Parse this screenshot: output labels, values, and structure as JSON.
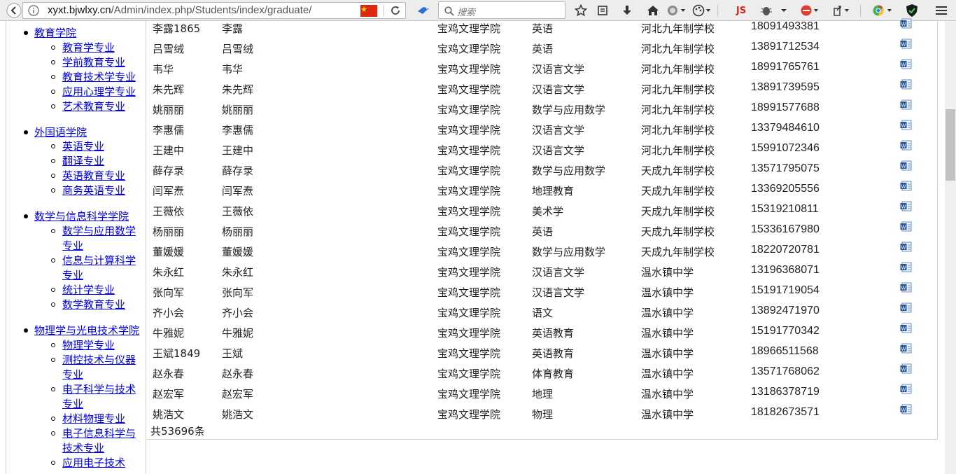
{
  "browser": {
    "url_host": "xyxt.bjwlxy.cn",
    "url_path": "/Admin/index.php/Students/index/graduate/",
    "search_placeholder": "搜索",
    "js_label": "JS",
    "accent_flag": "#d22",
    "icons": [
      "back-icon",
      "info-icon",
      "china-flag-icon",
      "reload-icon",
      "bird-icon",
      "search-icon",
      "star-icon",
      "reader-icon",
      "download-icon",
      "home-icon",
      "globe-icon",
      "palette-icon",
      "js-icon",
      "bug-icon",
      "addon-icon",
      "share-icon",
      "chrome-icon",
      "shield-icon",
      "menu-icon"
    ]
  },
  "sidebar": {
    "groups": [
      {
        "label": "教育学院",
        "items": [
          [
            "教育学专业"
          ],
          [
            "学前教育专业"
          ],
          [
            "教育技术学专业"
          ],
          [
            "应用心理学专业"
          ],
          [
            "艺术教育专业"
          ]
        ]
      },
      {
        "label": "外国语学院",
        "items": [
          [
            "英语专业"
          ],
          [
            "翻译专业"
          ],
          [
            "英语教育专业"
          ],
          [
            "商务英语专业"
          ]
        ]
      },
      {
        "label": "数学与信息科学学院",
        "items": [
          [
            "数学与应用数学",
            "专业"
          ],
          [
            "信息与计算科学",
            "专业"
          ],
          [
            "统计学专业"
          ],
          [
            "数学教育专业"
          ]
        ]
      },
      {
        "label": "物理学与光电技术学院",
        "items": [
          [
            "物理学专业"
          ],
          [
            "测控技术与仪器",
            "专业"
          ],
          [
            "电子科学与技术",
            "专业"
          ],
          [
            "材料物理专业"
          ],
          [
            "电子信息科学与",
            "技术专业"
          ],
          [
            "应用电子技术"
          ]
        ]
      }
    ]
  },
  "table": {
    "rows": [
      [
        "李露1865",
        "李露",
        "宝鸡文理学院",
        "英语",
        "河北九年制学校",
        "18091493381"
      ],
      [
        "吕雪绒",
        "吕雪绒",
        "宝鸡文理学院",
        "英语",
        "河北九年制学校",
        "13891712534"
      ],
      [
        "韦华",
        "韦华",
        "宝鸡文理学院",
        "汉语言文学",
        "河北九年制学校",
        "18991765761"
      ],
      [
        "朱先辉",
        "朱先辉",
        "宝鸡文理学院",
        "汉语言文学",
        "河北九年制学校",
        "13891739595"
      ],
      [
        "姚丽丽",
        "姚丽丽",
        "宝鸡文理学院",
        "数学与应用数学",
        "河北九年制学校",
        "18991577688"
      ],
      [
        "李惠儒",
        "李惠儒",
        "宝鸡文理学院",
        "汉语言文学",
        "河北九年制学校",
        "13379484610"
      ],
      [
        "王建中",
        "王建中",
        "宝鸡文理学院",
        "汉语言文学",
        "河北九年制学校",
        "15991072346"
      ],
      [
        "薛存录",
        "薛存录",
        "宝鸡文理学院",
        "数学与应用数学",
        "天成九年制学校",
        "13571795075"
      ],
      [
        "闫军焘",
        "闫军焘",
        "宝鸡文理学院",
        "地理教育",
        "天成九年制学校",
        "13369205556"
      ],
      [
        "王薇依",
        "王薇依",
        "宝鸡文理学院",
        "美术学",
        "天成九年制学校",
        "15319210811"
      ],
      [
        "杨丽丽",
        "杨丽丽",
        "宝鸡文理学院",
        "英语",
        "天成九年制学校",
        "15336167980"
      ],
      [
        "董媛媛",
        "董媛媛",
        "宝鸡文理学院",
        "数学与应用数学",
        "天成九年制学校",
        "18220720781"
      ],
      [
        "朱永红",
        "朱永红",
        "宝鸡文理学院",
        "汉语言文学",
        "温水镇中学",
        "13196368071"
      ],
      [
        "张向军",
        "张向军",
        "宝鸡文理学院",
        "汉语言文学",
        "温水镇中学",
        "15191719054"
      ],
      [
        "齐小会",
        "齐小会",
        "宝鸡文理学院",
        "语文",
        "温水镇中学",
        "13892471970"
      ],
      [
        "牛雅妮",
        "牛雅妮",
        "宝鸡文理学院",
        "英语教育",
        "温水镇中学",
        "15191770342"
      ],
      [
        "王斌1849",
        "王斌",
        "宝鸡文理学院",
        "英语教育",
        "温水镇中学",
        "18966511568"
      ],
      [
        "赵永春",
        "赵永春",
        "宝鸡文理学院",
        "体育教育",
        "温水镇中学",
        "13571768062"
      ],
      [
        "赵宏军",
        "赵宏军",
        "宝鸡文理学院",
        "地理",
        "温水镇中学",
        "13186378719"
      ],
      [
        "姚浩文",
        "姚浩文",
        "宝鸡文理学院",
        "物理",
        "温水镇中学",
        "18182673571"
      ]
    ],
    "total_label": "共53696条"
  }
}
